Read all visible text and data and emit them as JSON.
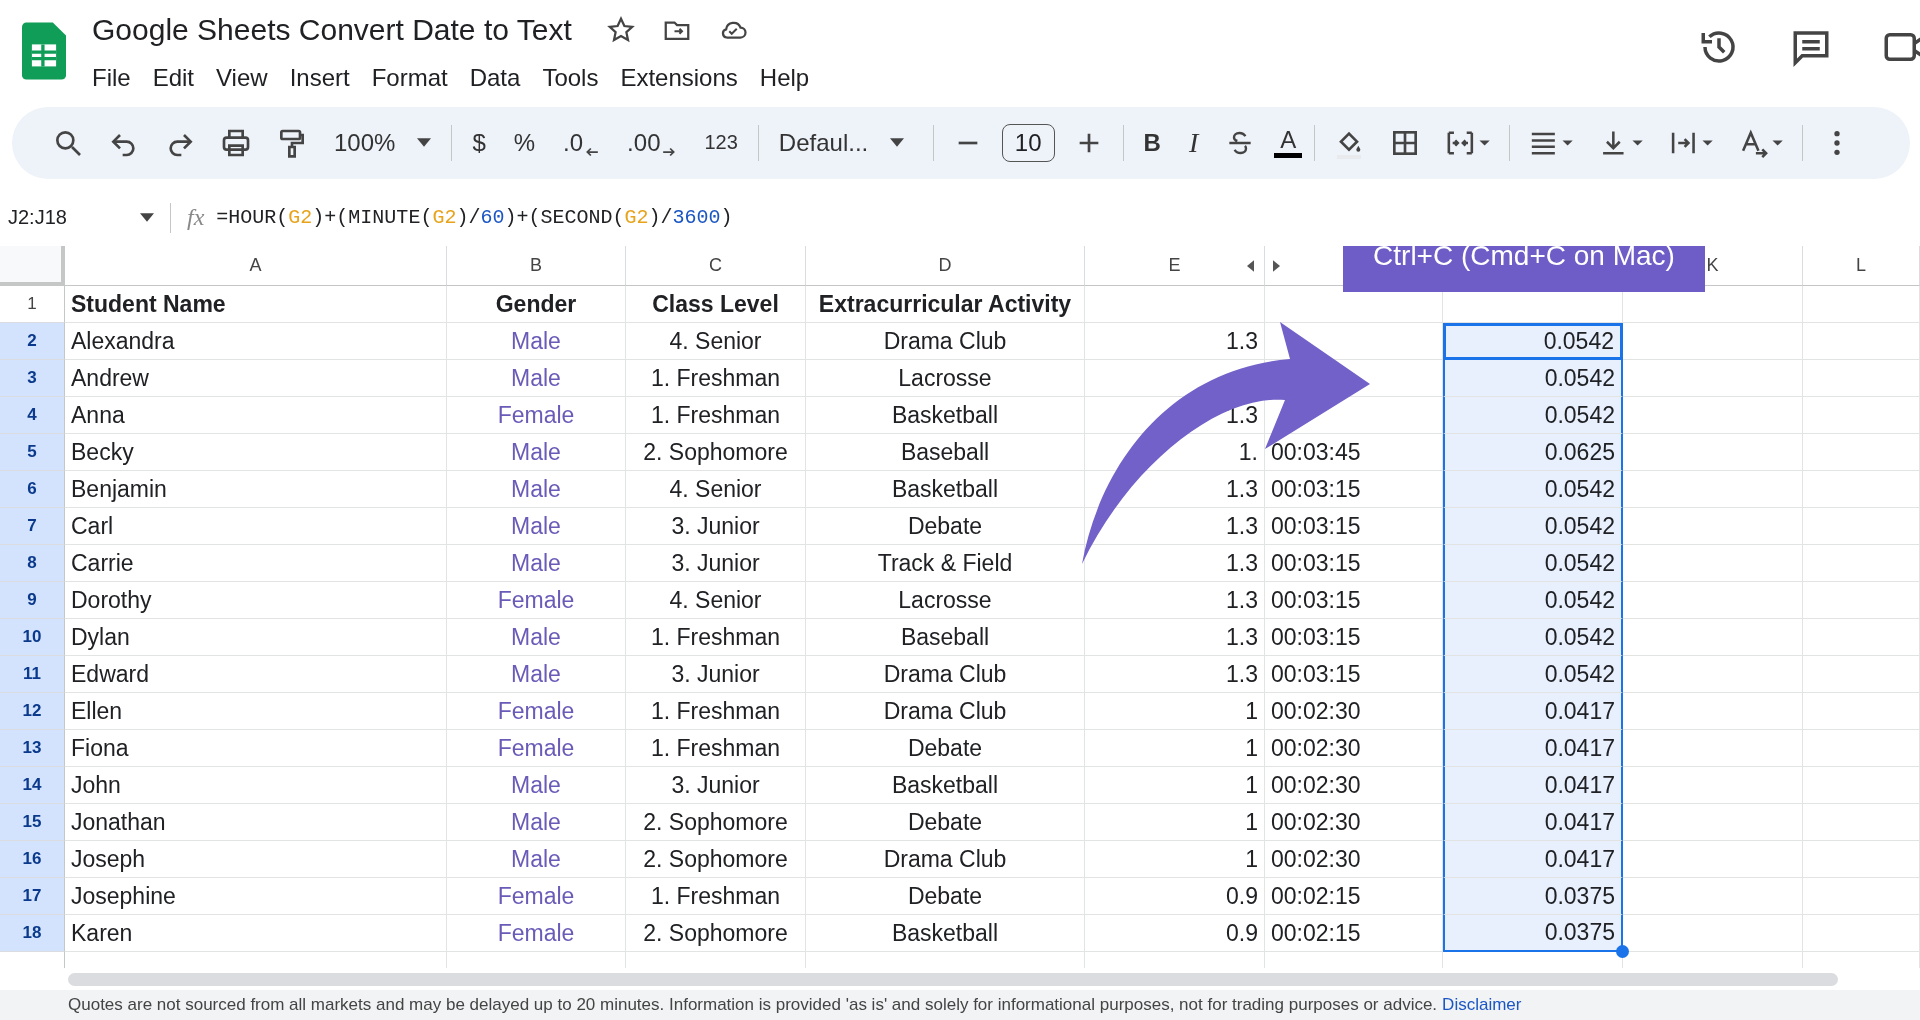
{
  "doc": {
    "title": "Google Sheets Convert Date to Text",
    "menu": [
      "File",
      "Edit",
      "View",
      "Insert",
      "Format",
      "Data",
      "Tools",
      "Extensions",
      "Help"
    ]
  },
  "toolbar": {
    "zoom": "100%",
    "currency": "$",
    "percent": "%",
    "dec_less": ".0",
    "dec_more": ".00",
    "number_format": "123",
    "font": "Defaul...",
    "font_size": "10",
    "bold": "B",
    "italic": "I",
    "text_color": "A"
  },
  "formula_bar": {
    "name_box": "J2:J18",
    "fx_label": "fx",
    "tokens": [
      {
        "kind": "text",
        "text": "=HOUR("
      },
      {
        "kind": "ref",
        "text": "G2"
      },
      {
        "kind": "text",
        "text": ")+(MINUTE("
      },
      {
        "kind": "ref",
        "text": "G2"
      },
      {
        "kind": "text",
        "text": ")/"
      },
      {
        "kind": "num",
        "text": "60"
      },
      {
        "kind": "text",
        "text": ")+(SECOND("
      },
      {
        "kind": "ref",
        "text": "G2"
      },
      {
        "kind": "text",
        "text": ")/"
      },
      {
        "kind": "num",
        "text": "3600"
      },
      {
        "kind": "text",
        "text": ")"
      }
    ]
  },
  "column_headers": [
    "A",
    "B",
    "C",
    "D",
    "E"
  ],
  "right_headers": [
    "K",
    "L"
  ],
  "header_row": {
    "number": "1",
    "cells": [
      "Student Name",
      "Gender",
      "Class Level",
      "Extracurricular Activity"
    ]
  },
  "rows": [
    {
      "number": "2",
      "name": "Alexandra",
      "gender": "Male",
      "level": "4. Senior",
      "activity": "Drama Club",
      "e": "1.3",
      "j": "0.0542",
      "selected": true,
      "active": true
    },
    {
      "number": "3",
      "name": "Andrew",
      "gender": "Male",
      "level": "1. Freshman",
      "activity": "Lacrosse",
      "j": "0.0542",
      "selected": true,
      "active": false
    },
    {
      "number": "4",
      "name": "Anna",
      "gender": "Female",
      "level": "1. Freshman",
      "activity": "Basketball",
      "e": "1.3",
      "j": "0.0542",
      "selected": true,
      "active": false
    },
    {
      "number": "5",
      "name": "Becky",
      "gender": "Male",
      "level": "2. Sophomore",
      "activity": "Baseball",
      "e": "1.",
      "time": "00:03:45",
      "j": "0.0625",
      "selected": true,
      "active": false
    },
    {
      "number": "6",
      "name": "Benjamin",
      "gender": "Male",
      "level": "4. Senior",
      "activity": "Basketball",
      "e": "1.3",
      "time": "00:03:15",
      "j": "0.0542",
      "selected": true,
      "active": false
    },
    {
      "number": "7",
      "name": "Carl",
      "gender": "Male",
      "level": "3. Junior",
      "activity": "Debate",
      "e": "1.3",
      "time": "00:03:15",
      "j": "0.0542",
      "selected": true,
      "active": false
    },
    {
      "number": "8",
      "name": "Carrie",
      "gender": "Male",
      "level": "3. Junior",
      "activity": "Track & Field",
      "e": "1.3",
      "time": "00:03:15",
      "j": "0.0542",
      "selected": true,
      "active": false
    },
    {
      "number": "9",
      "name": "Dorothy",
      "gender": "Female",
      "level": "4. Senior",
      "activity": "Lacrosse",
      "e": "1.3",
      "time": "00:03:15",
      "j": "0.0542",
      "selected": true,
      "active": false
    },
    {
      "number": "10",
      "name": "Dylan",
      "gender": "Male",
      "level": "1. Freshman",
      "activity": "Baseball",
      "e": "1.3",
      "time": "00:03:15",
      "j": "0.0542",
      "selected": true,
      "active": false
    },
    {
      "number": "11",
      "name": "Edward",
      "gender": "Male",
      "level": "3. Junior",
      "activity": "Drama Club",
      "e": "1.3",
      "time": "00:03:15",
      "j": "0.0542",
      "selected": true,
      "active": false
    },
    {
      "number": "12",
      "name": "Ellen",
      "gender": "Female",
      "level": "1. Freshman",
      "activity": "Drama Club",
      "e": "1",
      "time": "00:02:30",
      "j": "0.0417",
      "selected": true,
      "active": false
    },
    {
      "number": "13",
      "name": "Fiona",
      "gender": "Female",
      "level": "1. Freshman",
      "activity": "Debate",
      "e": "1",
      "time": "00:02:30",
      "j": "0.0417",
      "selected": true,
      "active": false
    },
    {
      "number": "14",
      "name": "John",
      "gender": "Male",
      "level": "3. Junior",
      "activity": "Basketball",
      "e": "1",
      "time": "00:02:30",
      "j": "0.0417",
      "selected": true,
      "active": false
    },
    {
      "number": "15",
      "name": "Jonathan",
      "gender": "Male",
      "level": "2. Sophomore",
      "activity": "Debate",
      "e": "1",
      "time": "00:02:30",
      "j": "0.0417",
      "selected": true,
      "active": false
    },
    {
      "number": "16",
      "name": "Joseph",
      "gender": "Male",
      "level": "2. Sophomore",
      "activity": "Drama Club",
      "e": "1",
      "time": "00:02:30",
      "j": "0.0417",
      "selected": true,
      "active": false
    },
    {
      "number": "17",
      "name": "Josephine",
      "gender": "Female",
      "level": "1. Freshman",
      "activity": "Debate",
      "e": "0.9",
      "time": "00:02:15",
      "j": "0.0375",
      "selected": true,
      "active": false
    },
    {
      "number": "18",
      "name": "Karen",
      "gender": "Female",
      "level": "2. Sophomore",
      "activity": "Basketball",
      "e": "0.9",
      "time": "00:02:15",
      "j": "0.0375",
      "selected": true,
      "active": false
    }
  ],
  "banner": "Ctrl+C (Cmd+C on Mac)",
  "footer": {
    "text": "Quotes are not sourced from all markets and may be delayed up to 20 minutes. Information is provided 'as is' and solely for informational purposes, not for trading purposes or advice.",
    "link": "Disclaimer"
  }
}
